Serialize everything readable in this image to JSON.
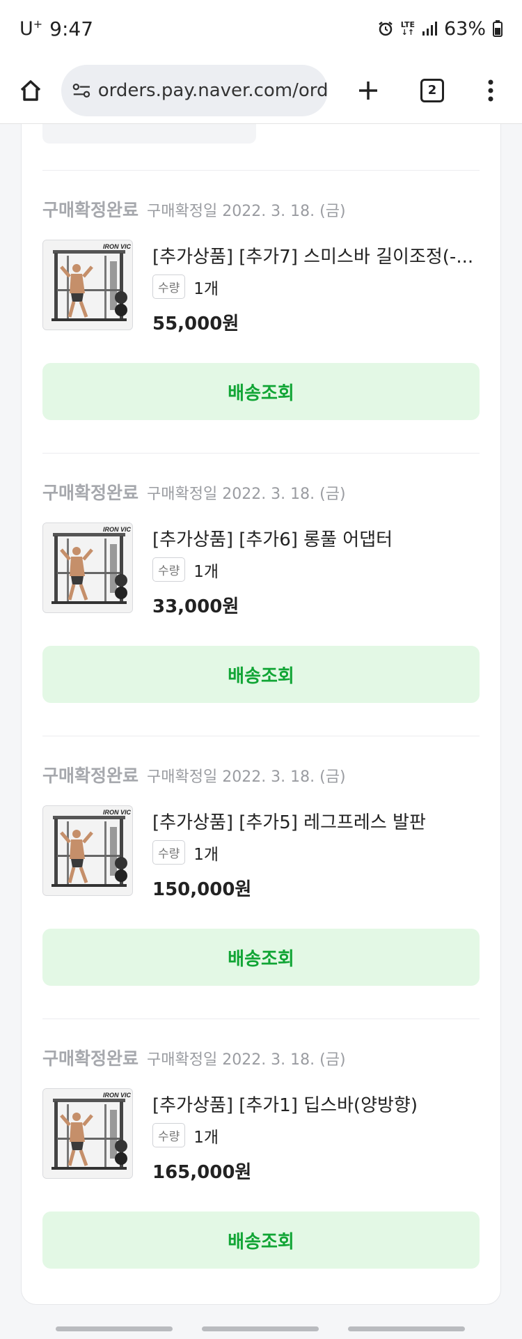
{
  "status_bar": {
    "carrier": "U",
    "carrier_sup": "+",
    "time": "9:47",
    "network": "LTE",
    "battery": "63%"
  },
  "browser": {
    "url": "orders.pay.naver.com/orders",
    "tab_count": "2"
  },
  "orders": [
    {
      "status": "구매확정완료",
      "confirm_date": "구매확정일 2022. 3. 18. (금)",
      "product_name": "[추가상품] [추가7] 스미스바 길이조정(-...",
      "qty_label": "수량",
      "qty": "1개",
      "price": "55,000원",
      "button_label": "배송조회",
      "thumb_brand": "IRON VIC"
    },
    {
      "status": "구매확정완료",
      "confirm_date": "구매확정일 2022. 3. 18. (금)",
      "product_name": "[추가상품] [추가6] 롱풀 어댑터",
      "qty_label": "수량",
      "qty": "1개",
      "price": "33,000원",
      "button_label": "배송조회",
      "thumb_brand": "IRON VIC"
    },
    {
      "status": "구매확정완료",
      "confirm_date": "구매확정일 2022. 3. 18. (금)",
      "product_name": "[추가상품] [추가5] 레그프레스 발판",
      "qty_label": "수량",
      "qty": "1개",
      "price": "150,000원",
      "button_label": "배송조회",
      "thumb_brand": "IRON VIC"
    },
    {
      "status": "구매확정완료",
      "confirm_date": "구매확정일 2022. 3. 18. (금)",
      "product_name": "[추가상품] [추가1] 딥스바(양방향)",
      "qty_label": "수량",
      "qty": "1개",
      "price": "165,000원",
      "button_label": "배송조회",
      "thumb_brand": "IRON VIC"
    }
  ],
  "colors": {
    "accent_green": "#11a535",
    "button_bg": "#e3f8e5",
    "status_gray": "#a6a8ad"
  }
}
